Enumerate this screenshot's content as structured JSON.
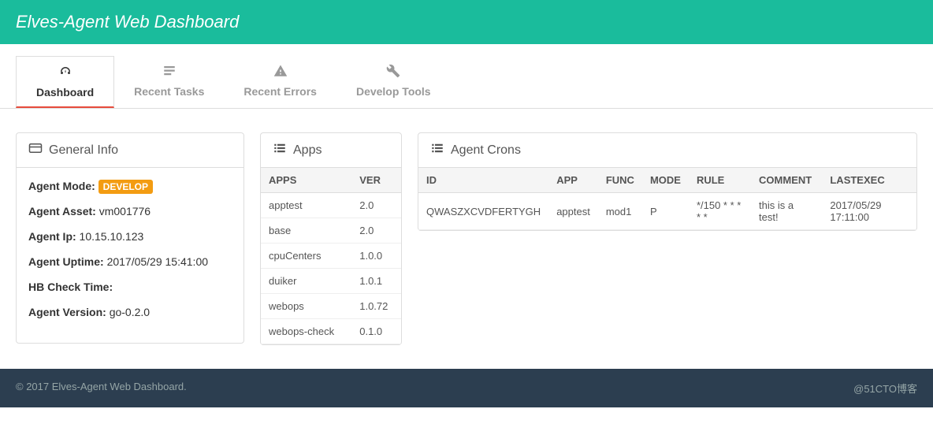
{
  "header": {
    "title": "Elves-Agent Web Dashboard"
  },
  "tabs": [
    {
      "label": "Dashboard",
      "icon": "dashboard-icon"
    },
    {
      "label": "Recent Tasks",
      "icon": "tasks-icon"
    },
    {
      "label": "Recent Errors",
      "icon": "errors-icon"
    },
    {
      "label": "Develop Tools",
      "icon": "tools-icon"
    }
  ],
  "general_info": {
    "title": "General Info",
    "mode_label": "Agent Mode:",
    "mode_value": "DEVELOP",
    "asset_label": "Agent Asset:",
    "asset_value": "vm001776",
    "ip_label": "Agent Ip:",
    "ip_value": "10.15.10.123",
    "uptime_label": "Agent Uptime:",
    "uptime_value": "2017/05/29 15:41:00",
    "hb_label": "HB Check Time:",
    "hb_value": "",
    "version_label": "Agent Version:",
    "version_value": "go-0.2.0"
  },
  "apps": {
    "title": "Apps",
    "headers": {
      "apps": "APPS",
      "ver": "VER"
    },
    "rows": [
      {
        "name": "apptest",
        "ver": "2.0"
      },
      {
        "name": "base",
        "ver": "2.0"
      },
      {
        "name": "cpuCenters",
        "ver": "1.0.0"
      },
      {
        "name": "duiker",
        "ver": "1.0.1"
      },
      {
        "name": "webops",
        "ver": "1.0.72"
      },
      {
        "name": "webops-check",
        "ver": "0.1.0"
      }
    ]
  },
  "crons": {
    "title": "Agent Crons",
    "headers": {
      "id": "ID",
      "app": "APP",
      "func": "FUNC",
      "mode": "MODE",
      "rule": "RULE",
      "comment": "COMMENT",
      "lastexec": "LASTEXEC"
    },
    "rows": [
      {
        "id": "QWASZXCVDFERTYGH",
        "app": "apptest",
        "func": "mod1",
        "mode": "P",
        "rule": "*/150 * * * * *",
        "comment": "this is a test!",
        "lastexec": "2017/05/29 17:11:00"
      }
    ]
  },
  "footer": {
    "copyright": "© 2017 Elves-Agent Web Dashboard.",
    "watermark": "@51CTO博客"
  }
}
